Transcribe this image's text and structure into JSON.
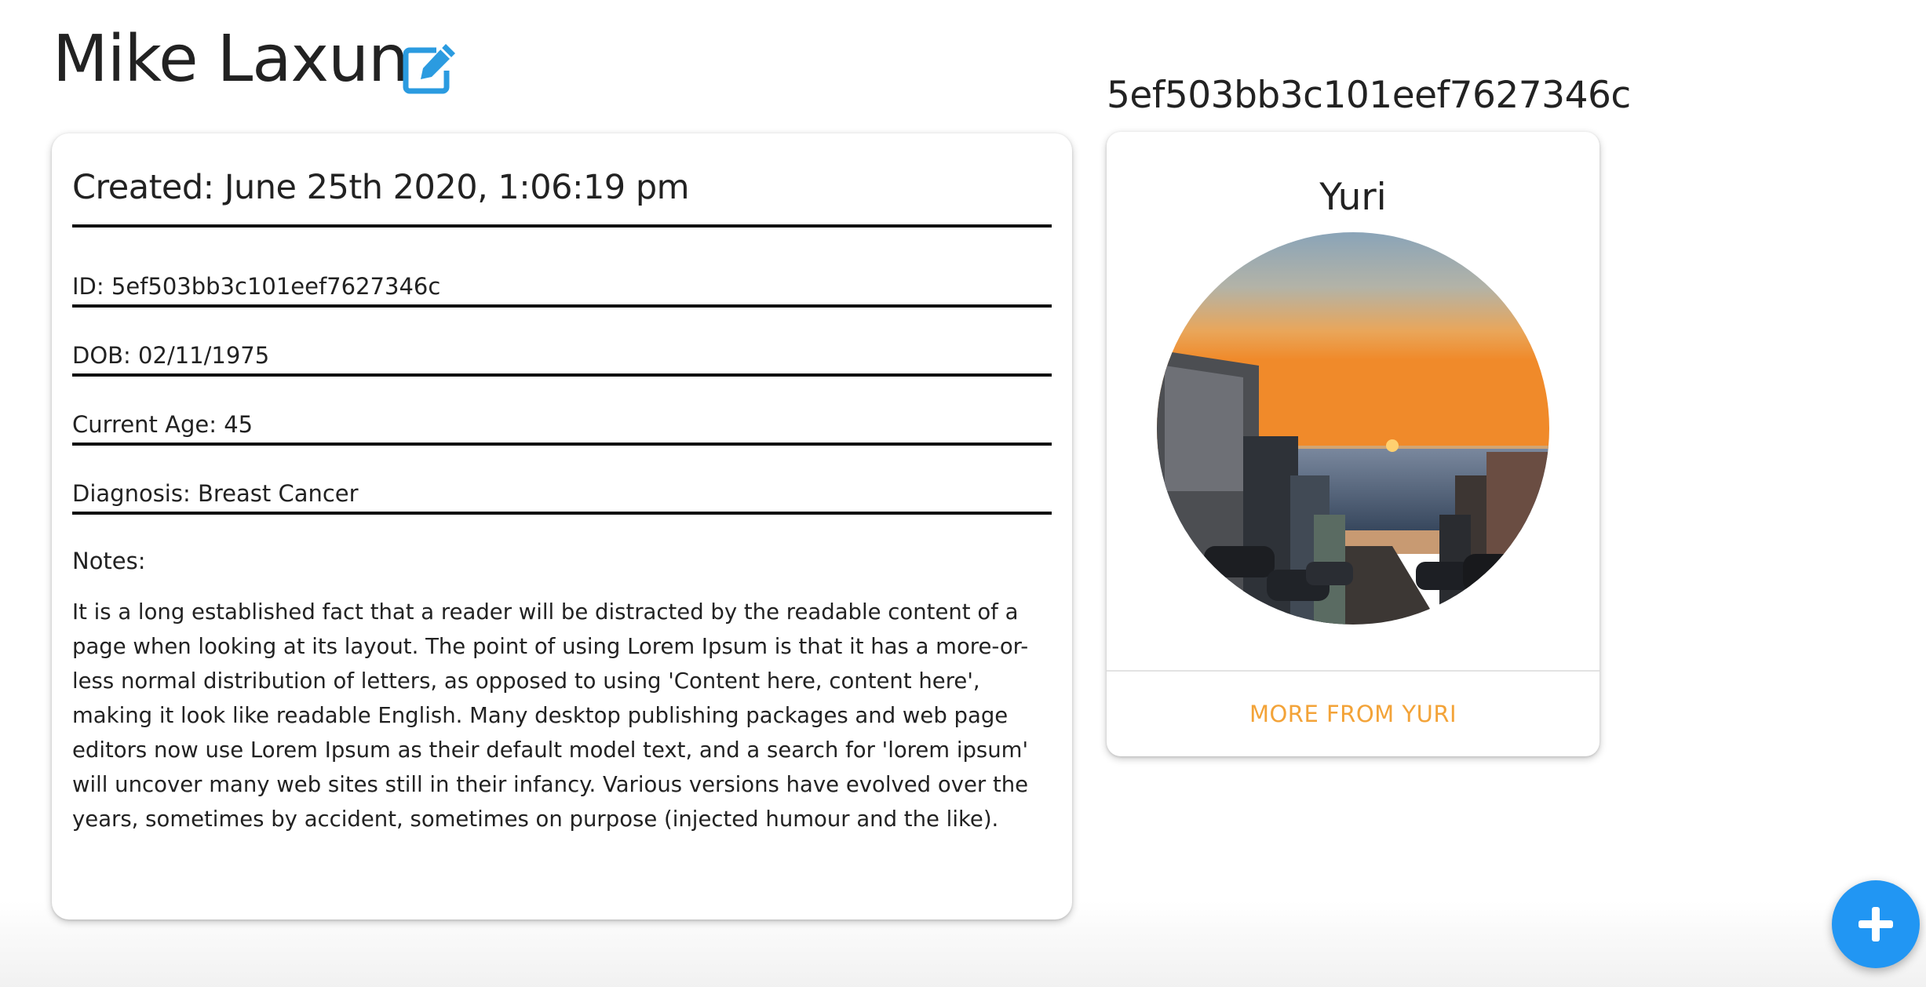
{
  "header": {
    "patient_name": "Mike Laxun",
    "edit_icon": "edit-icon"
  },
  "patient_card": {
    "created": "Created: June 25th 2020, 1:06:19 pm",
    "fields": [
      {
        "label": "ID: ",
        "value": "5ef503bb3c101eef7627346c"
      },
      {
        "label": "DOB: ",
        "value": "02/11/1975"
      },
      {
        "label": "Current Age: ",
        "value": "45"
      },
      {
        "label": "Diagnosis: ",
        "value": "Breast Cancer"
      }
    ],
    "notes_label": "Notes:",
    "notes_text": "It is a long established fact that a reader will be distracted by the readable content of a page when looking at its layout. The point of using Lorem Ipsum is that it has a more-or-less normal distribution of letters, as opposed to using 'Content here, content here', making it look like readable English. Many desktop publishing packages and web page editors now use Lorem Ipsum as their default model text, and a search for 'lorem ipsum' will uncover many web sites still in their infancy. Various versions have evolved over the years, sometimes by accident, sometimes on purpose (injected humour and the like)."
  },
  "doctor": {
    "id": "5ef503bb3c101eef7627346c",
    "name": "Yuri",
    "more_button": "MORE FROM YURI"
  },
  "fab": {
    "icon": "plus-icon"
  },
  "colors": {
    "accent_blue": "#2196f3",
    "edit_icon_blue": "#2b9be0",
    "more_button_orange": "#f3a338"
  }
}
